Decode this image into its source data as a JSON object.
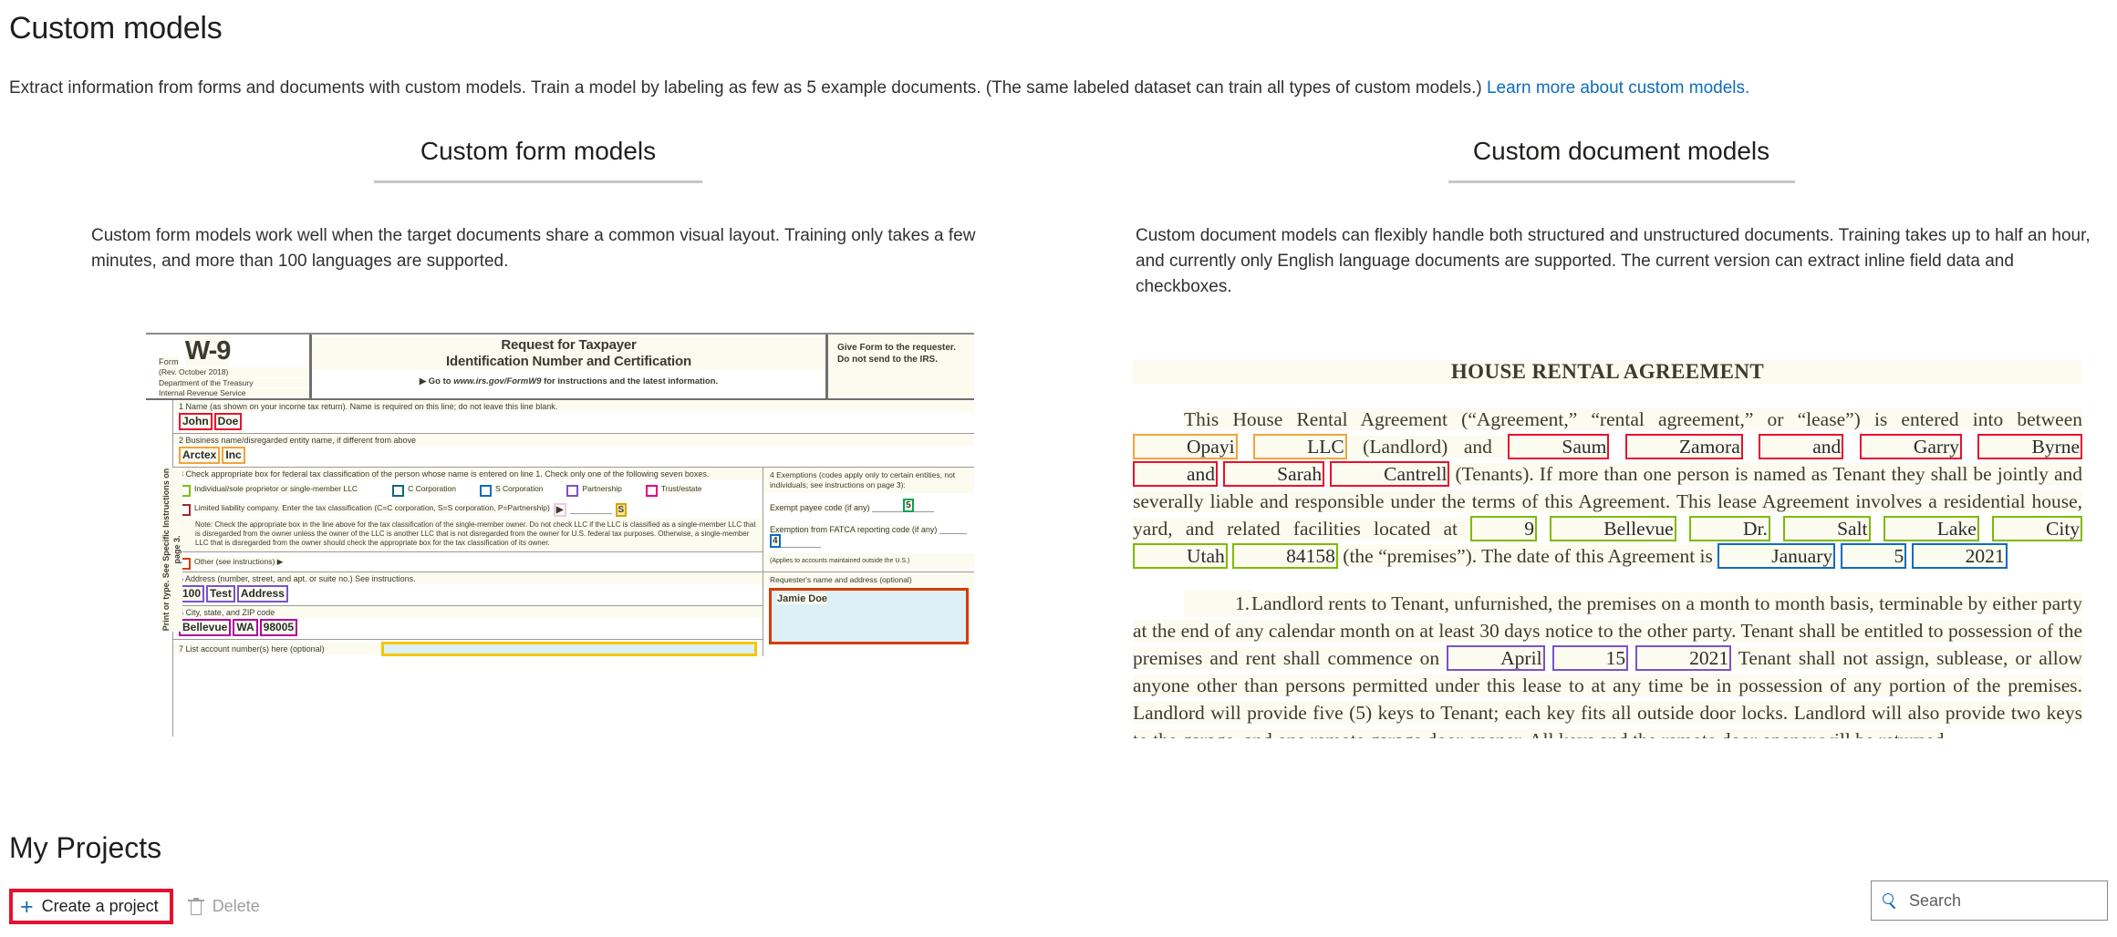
{
  "header": {
    "title": "Custom models",
    "description": "Extract information from forms and documents with custom models. Train a model by labeling as few as 5 example documents. (The same labeled dataset can train all types of custom models.)",
    "link_text": "Learn more about custom models."
  },
  "columns": {
    "form_models": {
      "heading": "Custom form models",
      "description": "Custom form models work well when the target documents share a common visual layout. Training only takes a few minutes, and more than 100 languages are supported."
    },
    "document_models": {
      "heading": "Custom document models",
      "description": "Custom document models can flexibly handle both structured and unstructured documents. Training takes up to half an hour, and currently only English language documents are supported. The current version can extract inline field data and checkboxes."
    }
  },
  "w9_form": {
    "form_label": "Form",
    "form_number": "W-9",
    "revision": "(Rev. October 2018)",
    "department_line1": "Department of the Treasury",
    "department_line2": "Internal Revenue Service",
    "title_line1": "Request for Taxpayer",
    "title_line2": "Identification Number and Certification",
    "goto_prefix": "▶ Go to ",
    "goto_url": "www.irs.gov/FormW9",
    "goto_suffix": " for instructions and the latest information.",
    "give_form_note": "Give Form to the requester. Do not send to the IRS.",
    "side_note": "Print or type. See Specific Instructions on page 3.",
    "line1_label": "1  Name (as shown on your income tax return). Name is required on this line; do not leave this line blank.",
    "line1_value_a": "John",
    "line1_value_b": "Doe",
    "line2_label": "2  Business name/disregarded entity name, if different from above",
    "line2_value_a": "Arctex",
    "line2_value_b": "Inc",
    "line3_label": "3  Check appropriate box for federal tax classification of the person whose name is entered on line 1. Check only one of the following seven boxes.",
    "checkbox_individual": "Individual/sole proprietor or single-member LLC",
    "checkbox_ccorp": "C Corporation",
    "checkbox_scorp": "S Corporation",
    "checkbox_partnership": "Partnership",
    "checkbox_trust": "Trust/estate",
    "checkbox_llc": "Limited liability company. Enter the tax classification (C=C corporation, S=S corporation, P=Partnership)",
    "llc_value": "S",
    "llc_note": "Note: Check the appropriate box in the line above for the tax classification of the single-member owner. Do not check LLC if the LLC is classified as a single-member LLC that is disregarded from the owner unless the owner of the LLC is another LLC that is not disregarded from the owner for U.S. federal tax purposes. Otherwise, a single-member LLC that is disregarded from the owner should check the appropriate box for the tax classification of its owner.",
    "checkbox_other": "Other (see instructions) ▶",
    "line5_label": "5  Address (number, street, and apt. or suite no.) See instructions.",
    "line5_value_a": "100",
    "line5_value_b": "Test",
    "line5_value_c": "Address",
    "line6_label": "6  City, state, and ZIP code",
    "line6_value_a": "Bellevue",
    "line6_value_b": "WA",
    "line6_value_c": "98005",
    "line7_label": "7  List account number(s) here (optional)",
    "line4_label": "4  Exemptions (codes apply only to certain entities, not individuals; see instructions on page 3):",
    "exempt_payee_label": "Exempt payee code (if any)",
    "exempt_payee_value": "5",
    "fatca_label": "Exemption from FATCA reporting code (if any)",
    "fatca_value": "4",
    "fatca_note": "(Applies to accounts maintained outside the U.S.)",
    "requester_label": "Requester's name and address (optional)",
    "requester_value": "Jamie Doe"
  },
  "rental_agreement": {
    "title": "HOUSE RENTAL AGREEMENT",
    "p1_a": "This House Rental Agreement (“Agreement,” “rental agreement,” or “lease”) is entered into between ",
    "landlord_a": "Opayi",
    "landlord_b": "LLC",
    "p1_b": " (Landlord) and ",
    "tenant_1": "Saum",
    "tenant_2": "Zamora",
    "tenant_and_1": "and",
    "tenant_3": "Garry",
    "tenant_4": "Byrne",
    "tenant_and_2": "and",
    "tenant_5": "Sarah",
    "tenant_6": "Cantrell",
    "p1_c": " (Tenants).   If more than one person is named as Tenant they shall be jointly and severally liable and responsible under the terms of this Agreement.  This lease Agreement involves a residential house, yard, and related facilities located at ",
    "addr_1": "9",
    "addr_2": "Bellevue",
    "addr_3": "Dr.",
    "addr_4": "Salt",
    "addr_5": "Lake",
    "addr_6": "City",
    "addr_7": "Utah",
    "addr_8": "84158",
    "p1_d": " (the “premises”). The date of this Agreement is ",
    "date_month": "January",
    "date_day": "5",
    "date_year": "2021",
    "p2_num": "1.",
    "p2_a": "Landlord rents to Tenant, unfurnished, the premises on a month to month basis, terminable by either party at the end of any calendar month on at least 30 days notice to the other party.  Tenant shall be entitled to possession of the premises and rent shall commence on ",
    "start_month": "April",
    "start_day": "15",
    "start_year": "2021",
    "p2_b": "  Tenant shall not assign, sublease, or allow anyone other than persons permitted under this lease to at any time be in possession of any portion of the premises.  Landlord will provide five (5) keys to Tenant; each key fits all outside door locks.  Landlord will also provide two keys to the garage, and one remote garage door opener.  All keys and the remote door opener will be returned"
  },
  "projects": {
    "title": "My Projects",
    "create_label": "Create a project",
    "delete_label": "Delete",
    "search_placeholder": "Search"
  },
  "colors": {
    "link": "#0f6cbd",
    "annotation_red": "#e8112d",
    "accent_orange": "#f2a33c"
  }
}
